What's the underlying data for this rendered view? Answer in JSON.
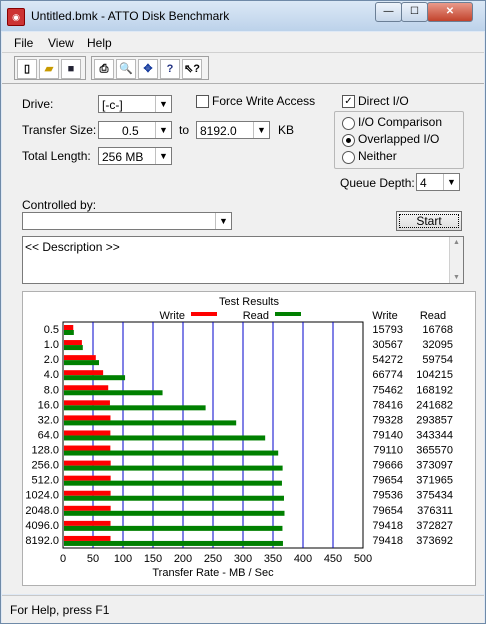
{
  "window": {
    "title": "Untitled.bmk - ATTO Disk Benchmark",
    "min": "—",
    "max": "☐",
    "close": "✕"
  },
  "menu": [
    "File",
    "View",
    "Help"
  ],
  "toolbar": [
    "new-icon",
    "open-icon",
    "save-icon",
    "print-icon",
    "print-preview-icon",
    "move-icon",
    "help-icon",
    "context-help-icon"
  ],
  "form": {
    "drive_label": "Drive:",
    "drive_value": "[-c-]",
    "force_write_label": "Force Write Access",
    "force_write_checked": false,
    "direct_io_label": "Direct I/O",
    "direct_io_checked": true,
    "transfer_size_label": "Transfer Size:",
    "transfer_from": "0.5",
    "to_label": "to",
    "transfer_to": "8192.0",
    "kb_label": "KB",
    "total_length_label": "Total Length:",
    "total_length_value": "256 MB",
    "mode_options": [
      "I/O Comparison",
      "Overlapped I/O",
      "Neither"
    ],
    "mode_selected": "Overlapped I/O",
    "queue_depth_label": "Queue Depth:",
    "queue_depth_value": "4",
    "controlled_by_label": "Controlled by:",
    "controlled_by_value": "",
    "start_label": "Start",
    "description": "<< Description >>"
  },
  "colors": {
    "write": "#ff0000",
    "read": "#008000",
    "gridline": "#0000cc"
  },
  "chart_data": {
    "type": "bar",
    "title": "Test Results",
    "xlabel": "Transfer Rate - MB / Sec",
    "xlim": [
      0,
      500
    ],
    "xticks": [
      0,
      50,
      100,
      150,
      200,
      250,
      300,
      350,
      400,
      450,
      500
    ],
    "legend": [
      "Write",
      "Read"
    ],
    "table_headers": [
      "Write",
      "Read"
    ],
    "categories": [
      "0.5",
      "1.0",
      "2.0",
      "4.0",
      "8.0",
      "16.0",
      "32.0",
      "64.0",
      "128.0",
      "256.0",
      "512.0",
      "1024.0",
      "2048.0",
      "4096.0",
      "8192.0"
    ],
    "series": [
      {
        "name": "Write",
        "values": [
          15793,
          30567,
          54272,
          66774,
          75462,
          78416,
          79328,
          79140,
          79110,
          79666,
          79654,
          79536,
          79654,
          79418,
          79418
        ]
      },
      {
        "name": "Read",
        "values": [
          16768,
          32095,
          59754,
          104215,
          168192,
          241682,
          293857,
          343344,
          365570,
          373097,
          371965,
          375434,
          376311,
          372827,
          373692
        ]
      }
    ]
  },
  "status": "For Help, press F1"
}
